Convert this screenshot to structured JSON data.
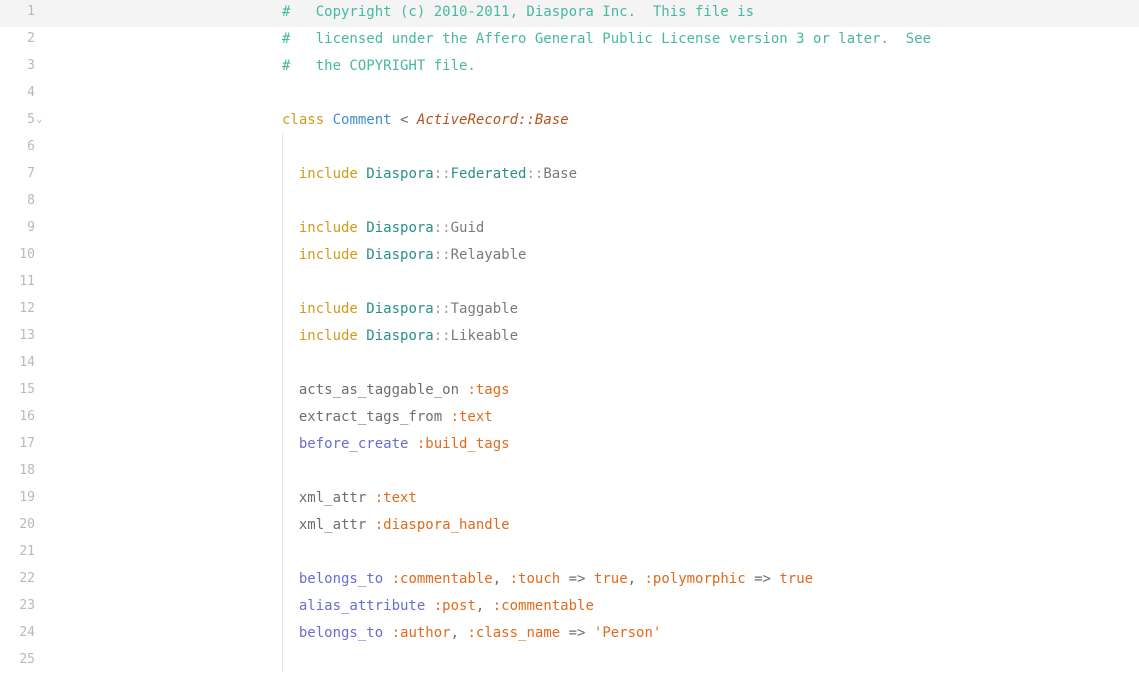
{
  "editor": {
    "lines": [
      {
        "num": "1",
        "tokens": [
          {
            "t": "#   Copyright (c) 2010-2011, Diaspora Inc.  This file is",
            "k": "comment"
          }
        ]
      },
      {
        "num": "2",
        "tokens": [
          {
            "t": "#   licensed under the Affero General Public License version 3 or later.  See",
            "k": "comment"
          }
        ]
      },
      {
        "num": "3",
        "tokens": [
          {
            "t": "#   the COPYRIGHT file.",
            "k": "comment"
          }
        ]
      },
      {
        "num": "4",
        "tokens": []
      },
      {
        "num": "5",
        "fold": true,
        "tokens": [
          {
            "t": "class",
            "k": "keyword"
          },
          {
            "t": " ",
            "k": "punct"
          },
          {
            "t": "Comment",
            "k": "classname"
          },
          {
            "t": " < ",
            "k": "operator"
          },
          {
            "t": "ActiveRecord::Base",
            "k": "superclass"
          }
        ]
      },
      {
        "num": "6",
        "tokens": []
      },
      {
        "num": "7",
        "tokens": [
          {
            "t": "  include",
            "k": "keyword"
          },
          {
            "t": " ",
            "k": "punct"
          },
          {
            "t": "Diaspora",
            "k": "module"
          },
          {
            "t": "::",
            "k": "sep"
          },
          {
            "t": "Federated",
            "k": "module"
          },
          {
            "t": "::",
            "k": "sep"
          },
          {
            "t": "Base",
            "k": "const"
          }
        ]
      },
      {
        "num": "8",
        "tokens": []
      },
      {
        "num": "9",
        "tokens": [
          {
            "t": "  include",
            "k": "keyword"
          },
          {
            "t": " ",
            "k": "punct"
          },
          {
            "t": "Diaspora",
            "k": "module"
          },
          {
            "t": "::",
            "k": "sep"
          },
          {
            "t": "Guid",
            "k": "const"
          }
        ]
      },
      {
        "num": "10",
        "tokens": [
          {
            "t": "  include",
            "k": "keyword"
          },
          {
            "t": " ",
            "k": "punct"
          },
          {
            "t": "Diaspora",
            "k": "module"
          },
          {
            "t": "::",
            "k": "sep"
          },
          {
            "t": "Relayable",
            "k": "const"
          }
        ]
      },
      {
        "num": "11",
        "tokens": []
      },
      {
        "num": "12",
        "tokens": [
          {
            "t": "  include",
            "k": "keyword"
          },
          {
            "t": " ",
            "k": "punct"
          },
          {
            "t": "Diaspora",
            "k": "module"
          },
          {
            "t": "::",
            "k": "sep"
          },
          {
            "t": "Taggable",
            "k": "const"
          }
        ]
      },
      {
        "num": "13",
        "tokens": [
          {
            "t": "  include",
            "k": "keyword"
          },
          {
            "t": " ",
            "k": "punct"
          },
          {
            "t": "Diaspora",
            "k": "module"
          },
          {
            "t": "::",
            "k": "sep"
          },
          {
            "t": "Likeable",
            "k": "const"
          }
        ]
      },
      {
        "num": "14",
        "tokens": []
      },
      {
        "num": "15",
        "tokens": [
          {
            "t": "  acts_as_taggable_on ",
            "k": "method"
          },
          {
            "t": ":tags",
            "k": "symbol"
          }
        ]
      },
      {
        "num": "16",
        "tokens": [
          {
            "t": "  extract_tags_from ",
            "k": "method"
          },
          {
            "t": ":text",
            "k": "symbol"
          }
        ]
      },
      {
        "num": "17",
        "tokens": [
          {
            "t": "  before_create",
            "k": "builtin"
          },
          {
            "t": " ",
            "k": "punct"
          },
          {
            "t": ":build_tags",
            "k": "symbol"
          }
        ]
      },
      {
        "num": "18",
        "tokens": []
      },
      {
        "num": "19",
        "tokens": [
          {
            "t": "  xml_attr ",
            "k": "method"
          },
          {
            "t": ":text",
            "k": "symbol"
          }
        ]
      },
      {
        "num": "20",
        "tokens": [
          {
            "t": "  xml_attr ",
            "k": "method"
          },
          {
            "t": ":diaspora_handle",
            "k": "symbol"
          }
        ]
      },
      {
        "num": "21",
        "tokens": []
      },
      {
        "num": "22",
        "tokens": [
          {
            "t": "  belongs_to",
            "k": "builtin"
          },
          {
            "t": " ",
            "k": "punct"
          },
          {
            "t": ":commentable",
            "k": "symbol"
          },
          {
            "t": ", ",
            "k": "punct"
          },
          {
            "t": ":touch",
            "k": "symbol"
          },
          {
            "t": " => ",
            "k": "operator"
          },
          {
            "t": "true",
            "k": "bool"
          },
          {
            "t": ", ",
            "k": "punct"
          },
          {
            "t": ":polymorphic",
            "k": "symbol"
          },
          {
            "t": " => ",
            "k": "operator"
          },
          {
            "t": "true",
            "k": "bool"
          }
        ]
      },
      {
        "num": "23",
        "tokens": [
          {
            "t": "  alias_attribute",
            "k": "builtin"
          },
          {
            "t": " ",
            "k": "punct"
          },
          {
            "t": ":post",
            "k": "symbol"
          },
          {
            "t": ", ",
            "k": "punct"
          },
          {
            "t": ":commentable",
            "k": "symbol"
          }
        ]
      },
      {
        "num": "24",
        "tokens": [
          {
            "t": "  belongs_to",
            "k": "builtin"
          },
          {
            "t": " ",
            "k": "punct"
          },
          {
            "t": ":author",
            "k": "symbol"
          },
          {
            "t": ", ",
            "k": "punct"
          },
          {
            "t": ":class_name",
            "k": "symbol"
          },
          {
            "t": " => ",
            "k": "operator"
          },
          {
            "t": "'Person'",
            "k": "string"
          }
        ]
      },
      {
        "num": "25",
        "tokens": []
      }
    ],
    "fold_icon": "chevron-down-icon",
    "current_line": 1
  }
}
